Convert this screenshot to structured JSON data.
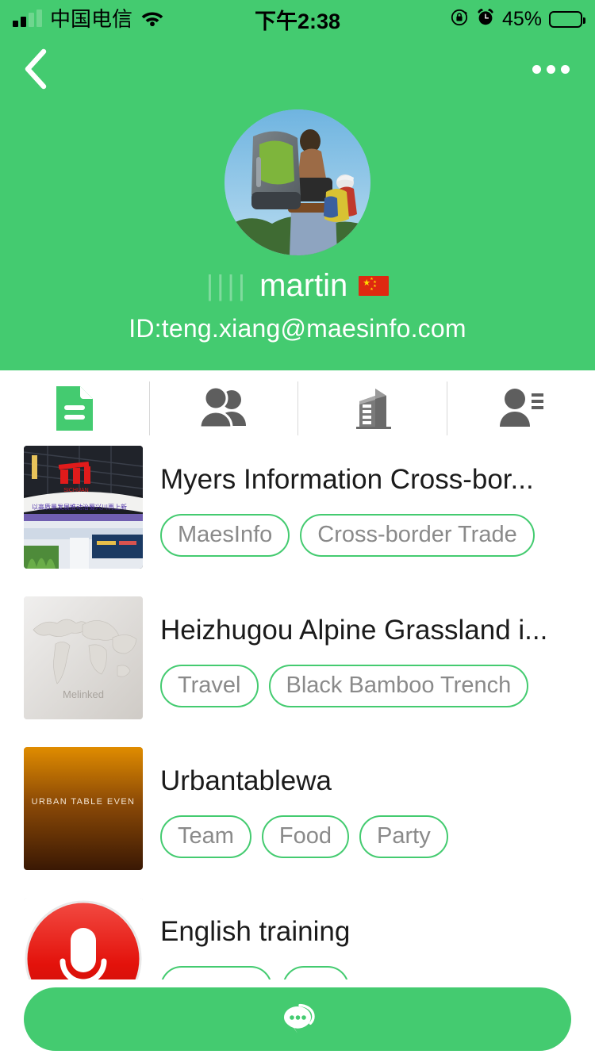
{
  "status_bar": {
    "carrier": "中国电信",
    "signal_icon": "signal-bars-icon",
    "wifi_icon": "wifi-icon",
    "time": "下午2:38",
    "rotation_lock_icon": "rotation-lock-icon",
    "alarm_icon": "alarm-clock-icon",
    "battery_percent": "45%",
    "battery_level": 45
  },
  "nav": {
    "back_icon": "back-chevron-icon",
    "more_icon": "more-options-icon"
  },
  "profile": {
    "avatar_icon": "user-avatar-hikers",
    "name_prefix": "||||",
    "name": "martin",
    "flag_icon": "china-flag-icon",
    "id": "ID:teng.xiang@maesinfo.com"
  },
  "tabs": [
    {
      "id": "documents",
      "icon": "document-icon",
      "active": true
    },
    {
      "id": "groups",
      "icon": "people-icon",
      "active": false
    },
    {
      "id": "company",
      "icon": "building-icon",
      "active": false
    },
    {
      "id": "contacts",
      "icon": "person-list-icon",
      "active": false
    }
  ],
  "list": [
    {
      "title": "Myers Information Cross-bor...",
      "thumb": "exhibition-hall-photo",
      "tags": [
        "MaesInfo",
        "Cross-border Trade"
      ]
    },
    {
      "title": "Heizhugou Alpine Grassland i...",
      "thumb": "melinked-world-map-placeholder",
      "thumb_caption": "Melinked",
      "tags": [
        "Travel",
        "Black Bamboo Trench"
      ]
    },
    {
      "title": "Urbantablewa",
      "thumb": "urban-table-event-poster",
      "thumb_caption": "URBAN TABLE EVEN",
      "tags": [
        "Team",
        "Food",
        "Party"
      ]
    },
    {
      "title": "English training",
      "thumb": "red-microphone-logo",
      "tags": []
    }
  ],
  "fab": {
    "icon": "chat-bubble-icon"
  },
  "colors": {
    "brand_green": "#44cb70",
    "tag_border": "#44cb70",
    "tag_text": "#8a8a8a",
    "title_text": "#1b1b1b",
    "tab_icon_inactive": "#5e5e5e",
    "flag_red": "#de2910",
    "flag_yellow": "#ffde00"
  }
}
